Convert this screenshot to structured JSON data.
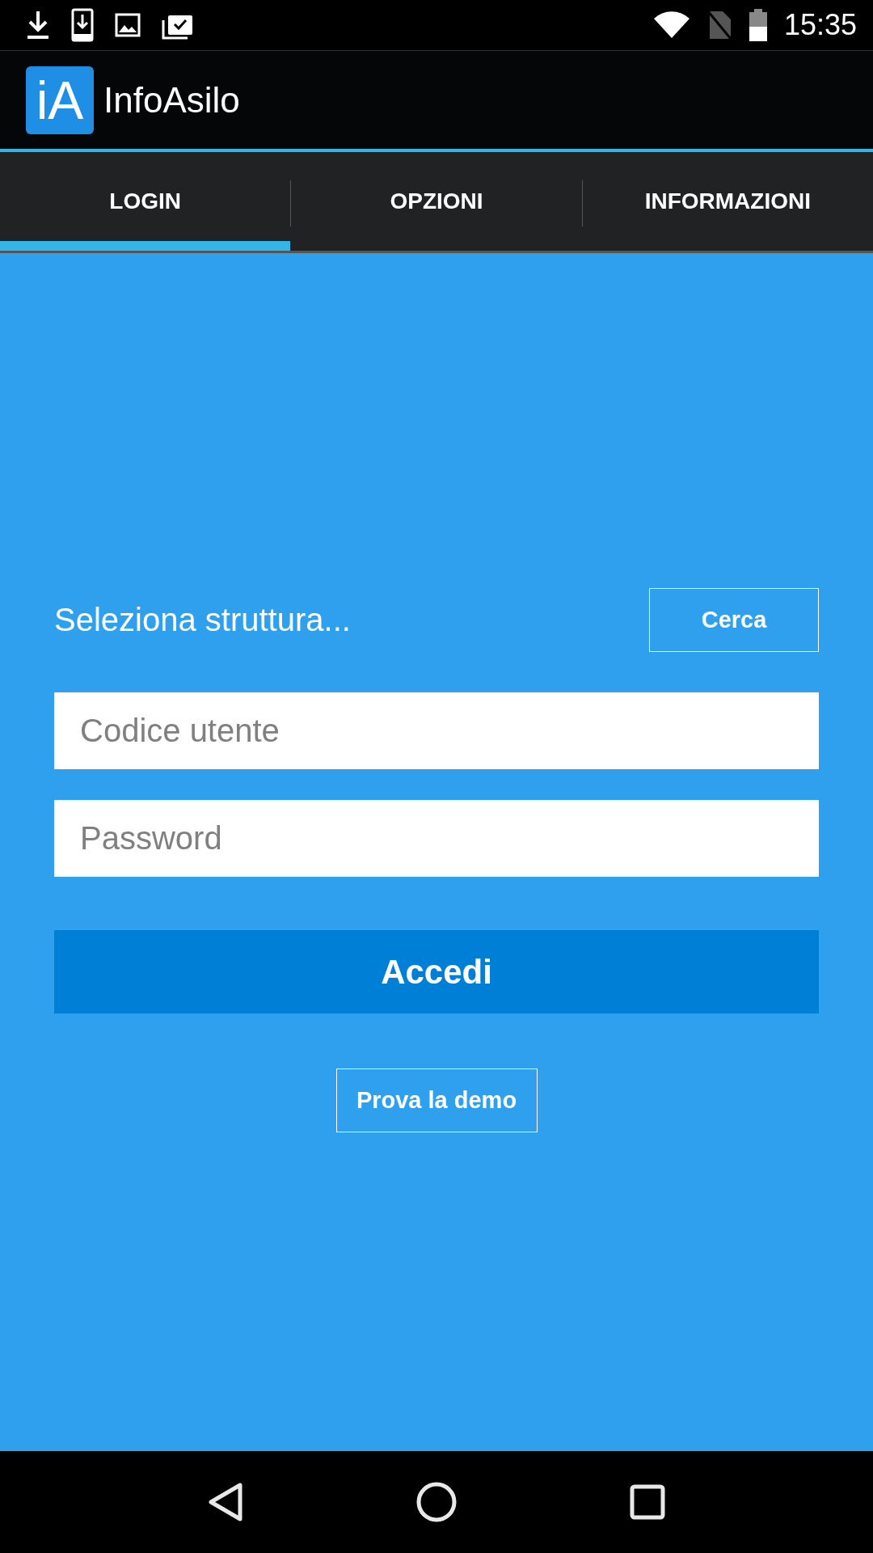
{
  "status_bar": {
    "time": "15:35"
  },
  "app_bar": {
    "logo": "iA",
    "title": "InfoAsilo"
  },
  "tabs": [
    {
      "label": "LOGIN",
      "selected": true
    },
    {
      "label": "OPZIONI",
      "selected": false
    },
    {
      "label": "INFORMAZIONI",
      "selected": false
    }
  ],
  "login": {
    "structure_label": "Seleziona struttura...",
    "search_button": "Cerca",
    "fields": [
      {
        "placeholder": "Codice utente"
      },
      {
        "placeholder": "Password"
      }
    ],
    "submit_button": "Accedi",
    "demo_button": "Prova la demo"
  }
}
